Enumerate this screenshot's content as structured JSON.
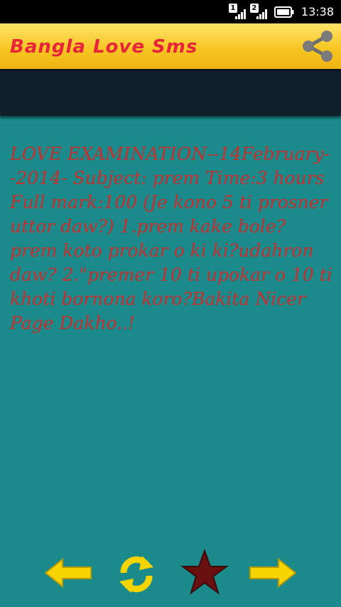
{
  "status_bar": {
    "sim1": "1",
    "sim2": "2",
    "time": "13:38"
  },
  "app_bar": {
    "title": "Bangla Love Sms",
    "share_icon": "share-icon"
  },
  "message": {
    "text": "LOVE EXAMINATION--14February--2014- Subject: prem Time:3 hours Full mark:100 (Je kono 5 ti prosner uttor daw?) 1.prem kake bole?prem koto prokar o ki ki?udahron daw? 2.\"premer 10 ti upokar o 10 ti khoti bornona koro?Bakita Nicer Page Dakho..!"
  },
  "bottom_bar": {
    "icons": [
      "arrow-left-icon",
      "refresh-icon",
      "star-icon",
      "arrow-right-icon"
    ]
  },
  "colors": {
    "background": "#1a8a8a",
    "app_bar": "#f7c623",
    "title": "#e8243a",
    "message_text": "#c62f2f",
    "band": "#0e1e2b",
    "star": "#6b1010",
    "arrow": "#f5d400"
  }
}
